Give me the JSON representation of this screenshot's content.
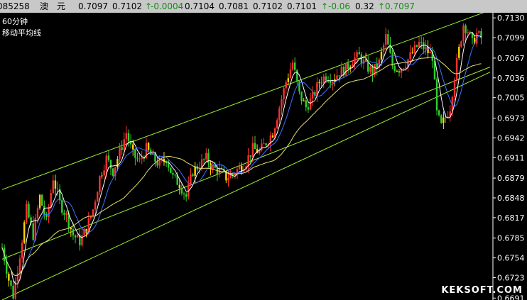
{
  "quote_bar": {
    "code": "085258",
    "name_1": "澳",
    "name_2": "元",
    "open": "0.7097",
    "high": "0.7102",
    "arrow_up": "↑",
    "change": "-0.0004",
    "v1": "0.7104",
    "v2": "0.7081",
    "v3": "0.7102",
    "v4": "0.7101",
    "change_2": "-0.06",
    "v5": "0.32",
    "last": "0.7097"
  },
  "chart_labels": {
    "period": "60分钟",
    "indicator": "移动平均线"
  },
  "watermark": "KEKSOFT.COM",
  "colors": {
    "background": "#000000",
    "up_candle": "#ff3030",
    "down_candle": "#30d030",
    "candle_yellow": "#ffd700",
    "ma_white": "#ffffff",
    "ma_blue": "#4070ff",
    "ma_yellow": "#e8e070",
    "channel": "#a0f030",
    "axis_text": "#ffffff"
  },
  "chart_data": {
    "type": "candlestick",
    "yaxis_ticks": [
      0.713,
      0.7099,
      0.7067,
      0.7036,
      0.7005,
      0.6973,
      0.6942,
      0.6911,
      0.6879,
      0.6848,
      0.6817,
      0.6785,
      0.6754,
      0.6723,
      0.6691
    ],
    "ylim": [
      0.6688,
      0.7138
    ],
    "channel_lines": [
      {
        "start": [
          0,
          0.6861
        ],
        "end": [
          220,
          0.7142
        ]
      },
      {
        "start": [
          0,
          0.6752
        ],
        "end": [
          220,
          0.7053
        ]
      },
      {
        "start": [
          0,
          0.6688
        ],
        "end": [
          220,
          0.7045
        ]
      }
    ],
    "price_path": [
      [
        0,
        0.677
      ],
      [
        3,
        0.672
      ],
      [
        5,
        0.6695
      ],
      [
        8,
        0.676
      ],
      [
        11,
        0.683
      ],
      [
        14,
        0.679
      ],
      [
        17,
        0.685
      ],
      [
        20,
        0.681
      ],
      [
        23,
        0.688
      ],
      [
        26,
        0.684
      ],
      [
        29,
        0.682
      ],
      [
        32,
        0.679
      ],
      [
        35,
        0.678
      ],
      [
        38,
        0.68
      ],
      [
        41,
        0.683
      ],
      [
        44,
        0.688
      ],
      [
        47,
        0.691
      ],
      [
        50,
        0.689
      ],
      [
        53,
        0.692
      ],
      [
        56,
        0.695
      ],
      [
        59,
        0.6915
      ],
      [
        62,
        0.6905
      ],
      [
        65,
        0.6925
      ],
      [
        68,
        0.691
      ],
      [
        71,
        0.69
      ],
      [
        74,
        0.691
      ],
      [
        77,
        0.688
      ],
      [
        80,
        0.687
      ],
      [
        83,
        0.685
      ],
      [
        86,
        0.689
      ],
      [
        89,
        0.69
      ],
      [
        92,
        0.691
      ],
      [
        95,
        0.6895
      ],
      [
        98,
        0.689
      ],
      [
        101,
        0.688
      ],
      [
        104,
        0.6885
      ],
      [
        107,
        0.6895
      ],
      [
        110,
        0.6905
      ],
      [
        113,
        0.6925
      ],
      [
        116,
        0.692
      ],
      [
        119,
        0.6935
      ],
      [
        122,
        0.695
      ],
      [
        125,
        0.699
      ],
      [
        128,
        0.703
      ],
      [
        131,
        0.706
      ],
      [
        134,
        0.701
      ],
      [
        137,
        0.699
      ],
      [
        140,
        0.7005
      ],
      [
        143,
        0.703
      ],
      [
        146,
        0.704
      ],
      [
        149,
        0.7035
      ],
      [
        152,
        0.7045
      ],
      [
        155,
        0.705
      ],
      [
        158,
        0.7065
      ],
      [
        161,
        0.707
      ],
      [
        164,
        0.7055
      ],
      [
        167,
        0.7045
      ],
      [
        170,
        0.706
      ],
      [
        173,
        0.71
      ],
      [
        176,
        0.7055
      ],
      [
        179,
        0.705
      ],
      [
        182,
        0.706
      ],
      [
        185,
        0.7075
      ],
      [
        188,
        0.709
      ],
      [
        191,
        0.708
      ],
      [
        194,
        0.707
      ],
      [
        196,
        0.698
      ],
      [
        198,
        0.696
      ],
      [
        200,
        0.6975
      ],
      [
        202,
        0.699
      ],
      [
        204,
        0.704
      ],
      [
        206,
        0.708
      ],
      [
        208,
        0.712
      ],
      [
        210,
        0.711
      ],
      [
        212,
        0.709
      ],
      [
        214,
        0.7105
      ],
      [
        216,
        0.7098
      ]
    ]
  }
}
